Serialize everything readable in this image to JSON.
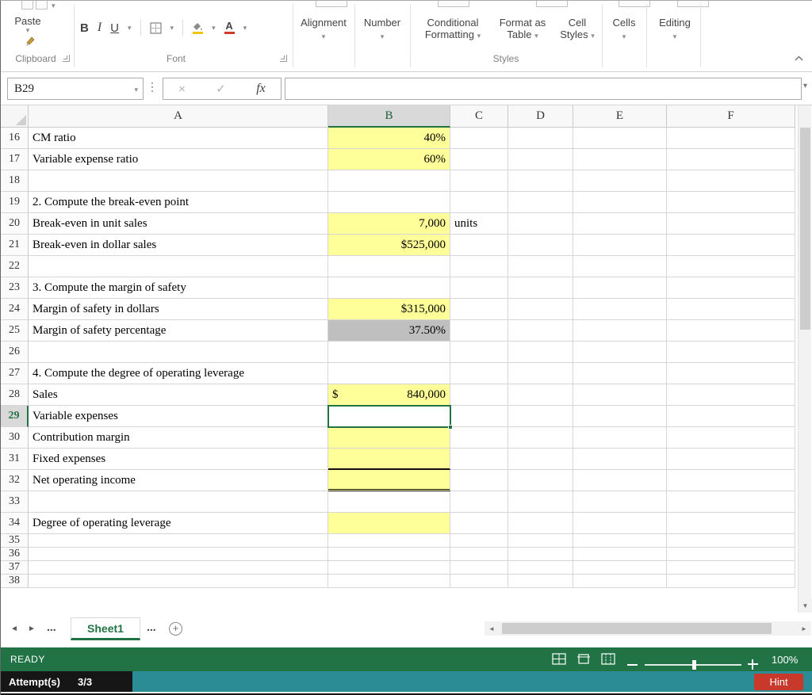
{
  "window": {
    "ribbon": {
      "paste_label": "Paste",
      "bold_label": "B",
      "italic_label": "I",
      "underline_label": "U",
      "alignment_label": "Alignment",
      "number_label": "Number",
      "conditional_formatting_line1": "Conditional",
      "conditional_formatting_line2": "Formatting",
      "format_as_table_line1": "Format as",
      "format_as_table_line2": "Table",
      "cell_styles_line1": "Cell",
      "cell_styles_line2": "Styles",
      "cells_label": "Cells",
      "editing_label": "Editing",
      "group_labels": {
        "clipboard": "Clipboard",
        "font": "Font",
        "styles": "Styles"
      }
    },
    "formula_bar": {
      "name_box_value": "B29",
      "cancel_label": "×",
      "enter_label": "✓",
      "fx_label": "fx",
      "formula_value": ""
    }
  },
  "sheet": {
    "selected_cell": "B29",
    "selected_column": "B",
    "selected_row": "29",
    "column_headers": [
      "A",
      "B",
      "C",
      "D",
      "E",
      "F"
    ],
    "rows": [
      {
        "num": "16",
        "a": "CM ratio",
        "b": "40%",
        "fill": "yellow"
      },
      {
        "num": "17",
        "a": "Variable expense ratio",
        "b": "60%",
        "fill": "yellow"
      },
      {
        "num": "18"
      },
      {
        "num": "19",
        "a": "2. Compute the break-even point"
      },
      {
        "num": "20",
        "a": "Break-even in unit sales",
        "b": "7,000",
        "c": "units",
        "fill": "yellow"
      },
      {
        "num": "21",
        "a": "Break-even in dollar sales",
        "b": "$525,000",
        "fill": "yellow"
      },
      {
        "num": "22"
      },
      {
        "num": "23",
        "a": "3. Compute the margin of safety"
      },
      {
        "num": "24",
        "a": "Margin of safety in dollars",
        "b": "$315,000",
        "fill": "yellow"
      },
      {
        "num": "25",
        "a": "Margin of safety percentage",
        "b": "37.50%",
        "fill": "gray"
      },
      {
        "num": "26"
      },
      {
        "num": "27",
        "a": "4. Compute the degree of operating leverage"
      },
      {
        "num": "28",
        "a": "Sales",
        "b_prefix": "$",
        "b": "840,000",
        "fill": "yellow"
      },
      {
        "num": "29",
        "a": "Variable expenses",
        "selected": true
      },
      {
        "num": "30",
        "a": "Contribution margin",
        "fill": "yellow"
      },
      {
        "num": "31",
        "a": "Fixed expenses",
        "fill": "yellow",
        "underline": "single"
      },
      {
        "num": "32",
        "a": "Net operating income",
        "fill": "yellow",
        "underline": "double"
      },
      {
        "num": "33"
      },
      {
        "num": "34",
        "a": "Degree of operating leverage",
        "fill": "yellow"
      },
      {
        "num": "35",
        "h": 17
      },
      {
        "num": "36",
        "h": 17
      },
      {
        "num": "37",
        "h": 17
      },
      {
        "num": "38",
        "h": 17
      }
    ]
  },
  "sheet_tabs": {
    "overflow_left": "...",
    "active_tab": "Sheet1",
    "overflow_right": "...",
    "new_sheet": "+"
  },
  "status_bar": {
    "mode": "READY",
    "zoom_level": "100%"
  },
  "footer": {
    "attempts_label": "Attempt(s)",
    "attempts_value": "3/3",
    "hint_button": "Hint"
  },
  "icons": {
    "dropdown": "▾",
    "scroll_down": "▼",
    "scroll_left": "◄",
    "scroll_right": "►",
    "tab_nav_left": "◄",
    "tab_nav_right": "►"
  },
  "colors": {
    "excel_green": "#217346",
    "cell_fill_yellow": "#FFFF99",
    "cell_fill_gray": "#BFBFBF",
    "footer_teal": "#2B8C96",
    "hint_red": "#C9392B"
  }
}
